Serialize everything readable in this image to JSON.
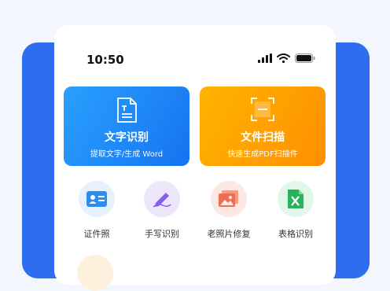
{
  "status_bar": {
    "time": "10:50"
  },
  "cards": [
    {
      "title": "文字识别",
      "subtitle": "提取文字/生成 Word",
      "icon": "document-text-icon"
    },
    {
      "title": "文件扫描",
      "subtitle": "快速生成PDF扫描件",
      "icon": "scan-frame-icon"
    }
  ],
  "tools": [
    {
      "label": "证件照",
      "icon": "id-card-icon"
    },
    {
      "label": "手写识别",
      "icon": "pen-icon"
    },
    {
      "label": "老照片修复",
      "icon": "photo-icon"
    },
    {
      "label": "表格识别",
      "icon": "excel-icon"
    }
  ],
  "colors": {
    "background_blue": "#2f6df0",
    "card_blue": "#1f8bf8",
    "card_orange": "#ffa000"
  }
}
